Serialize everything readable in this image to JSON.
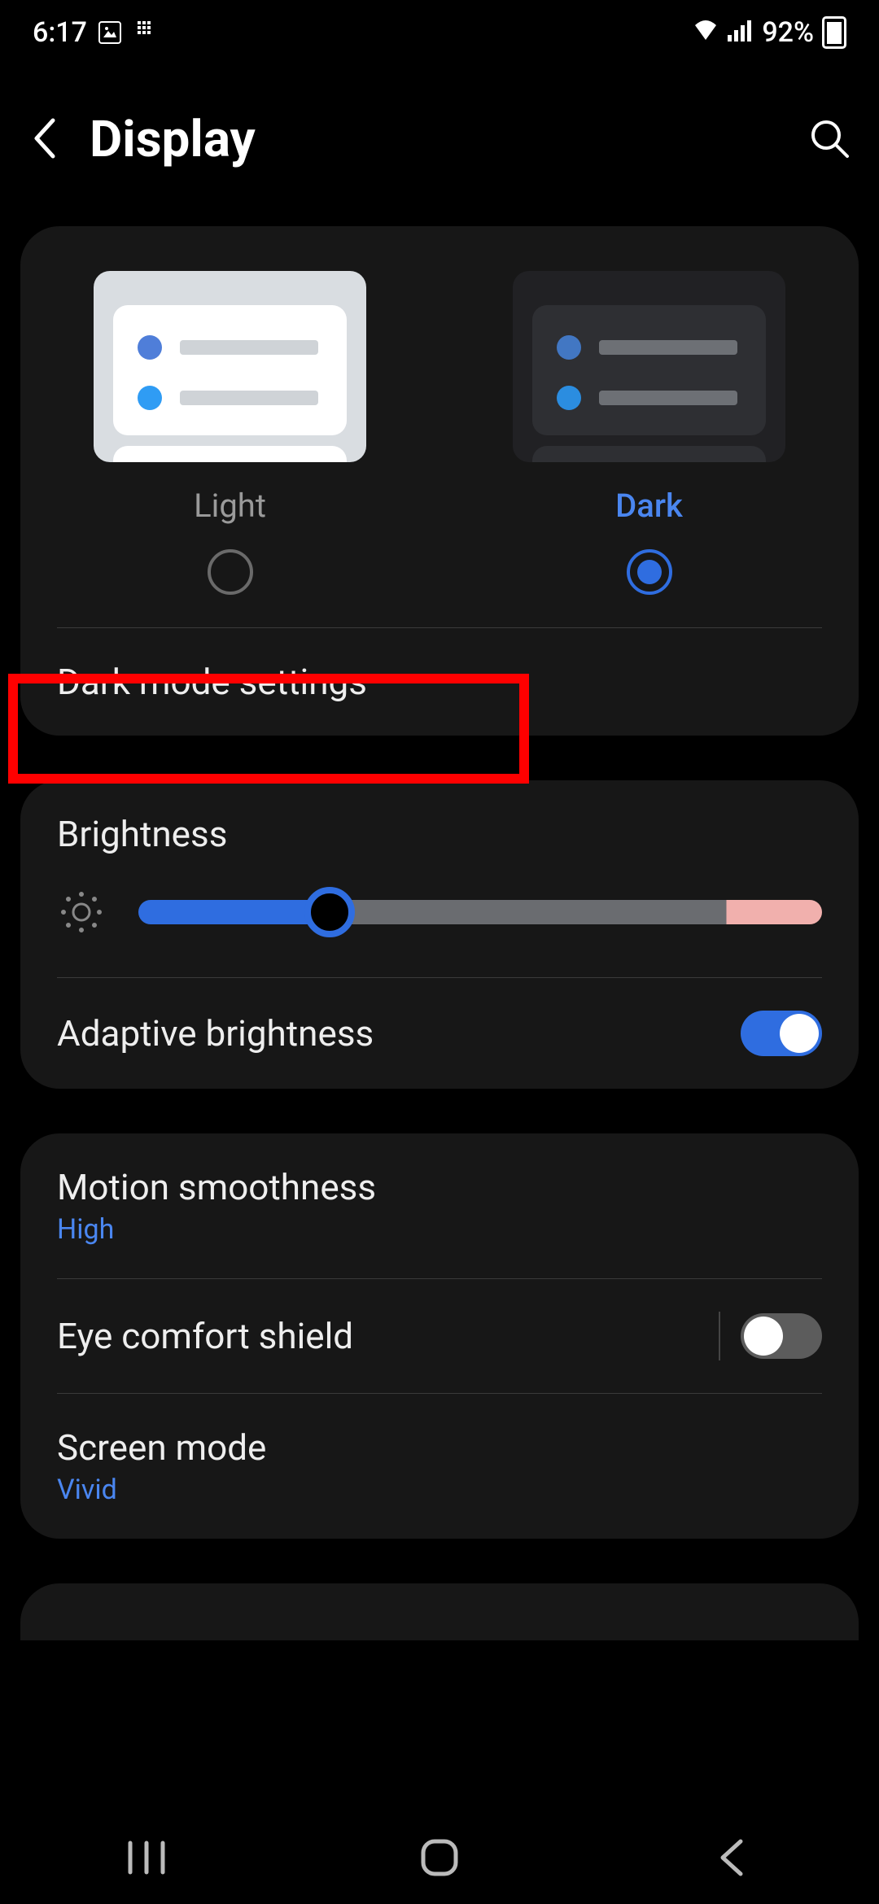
{
  "status": {
    "time": "6:17",
    "battery_pct": "92%"
  },
  "header": {
    "title": "Display"
  },
  "theme": {
    "light_label": "Light",
    "dark_label": "Dark",
    "selected": "dark"
  },
  "items": {
    "dark_mode_settings": "Dark mode settings",
    "brightness": "Brightness",
    "adaptive_brightness": "Adaptive brightness",
    "motion_smoothness": "Motion smoothness",
    "motion_smoothness_value": "High",
    "eye_comfort_shield": "Eye comfort shield",
    "screen_mode": "Screen mode",
    "screen_mode_value": "Vivid"
  },
  "states": {
    "brightness_pct": 28,
    "adaptive_brightness_on": true,
    "eye_comfort_on": false
  }
}
